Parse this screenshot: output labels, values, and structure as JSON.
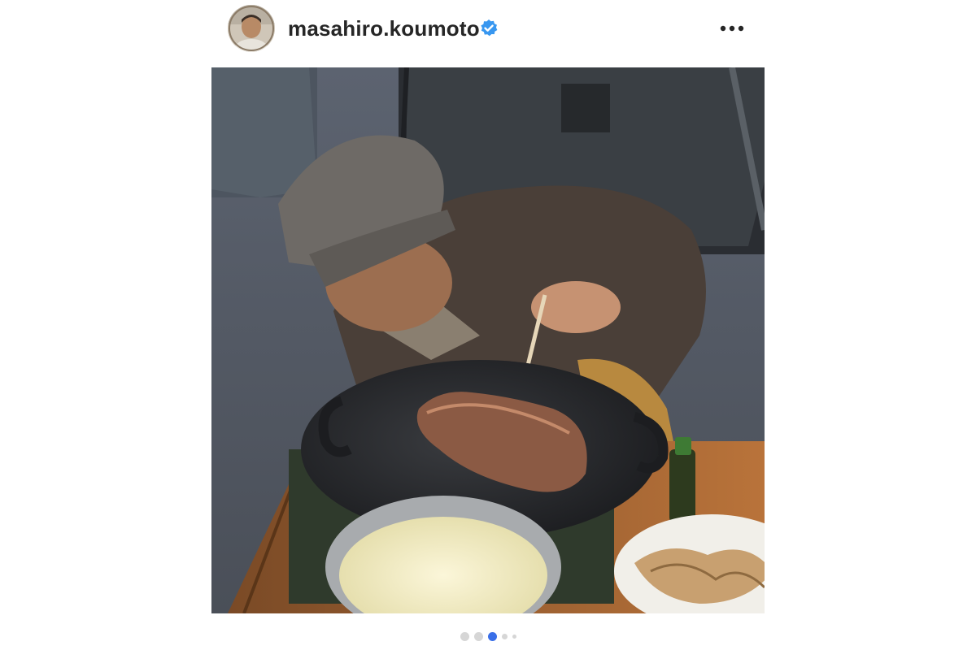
{
  "post": {
    "username": "masahiro.koumoto",
    "verified": true,
    "more_icon": "more-horizontal-icon",
    "avatar_icon": "profile-avatar",
    "photo": "post-photo-grilling-steak"
  },
  "carousel": {
    "total_dots": 5,
    "active_index": 2
  },
  "colors": {
    "verified_badge": "#3897f0",
    "active_dot": "#3a6fe8",
    "inactive_dot": "#d6d6d6",
    "username_text": "#262626"
  }
}
